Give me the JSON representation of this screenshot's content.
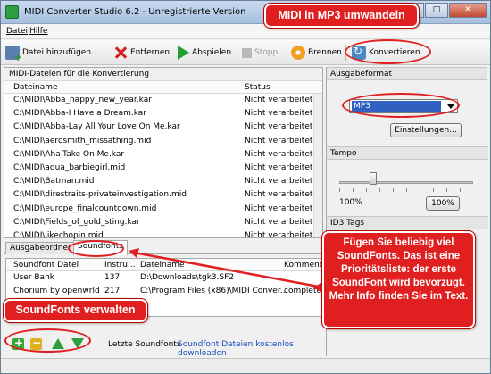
{
  "window": {
    "title": "MIDI Converter Studio 6.2 - Unregistrierte Version"
  },
  "menu": {
    "items": [
      "Datei",
      "Hilfe"
    ]
  },
  "toolbar": {
    "add_files": "Datei hinzufügen...",
    "remove": "Entfernen",
    "play": "Abspielen",
    "stop": "Stopp",
    "burn": "Brennen",
    "convert": "Konvertieren"
  },
  "file_list": {
    "title": "MIDI-Dateien für die Konvertierung",
    "columns": [
      "Dateiname",
      "Status"
    ],
    "rows": [
      {
        "name": "C:\\MIDI\\Abba_happy_new_year.kar",
        "status": "Nicht verarbeitet"
      },
      {
        "name": "C:\\MIDI\\Abba-I Have a Dream.kar",
        "status": "Nicht verarbeitet"
      },
      {
        "name": "C:\\MIDI\\Abba-Lay All Your Love On Me.kar",
        "status": "Nicht verarbeitet"
      },
      {
        "name": "C:\\MIDI\\aerosmith_missathing.mid",
        "status": "Nicht verarbeitet"
      },
      {
        "name": "C:\\MIDI\\Aha-Take On Me.kar",
        "status": "Nicht verarbeitet"
      },
      {
        "name": "C:\\MIDI\\aqua_barbiegirl.mid",
        "status": "Nicht verarbeitet"
      },
      {
        "name": "C:\\MIDI\\Batman.mid",
        "status": "Nicht verarbeitet"
      },
      {
        "name": "C:\\MIDI\\direstraits-privateinvestigation.mid",
        "status": "Nicht verarbeitet"
      },
      {
        "name": "C:\\MIDI\\europe_finalcountdown.mid",
        "status": "Nicht verarbeitet"
      },
      {
        "name": "C:\\MIDI\\Fields_of_gold_sting.kar",
        "status": "Nicht verarbeitet"
      },
      {
        "name": "C:\\MIDI\\likechopin.mid",
        "status": "Nicht verarbeitet"
      }
    ]
  },
  "tabs": [
    "Ausgabeordner",
    "Soundfonts"
  ],
  "soundfonts": {
    "columns": [
      "Soundfont Datei",
      "Instru...",
      "Dateiname",
      "Kommenta"
    ],
    "rows": [
      {
        "file": "User Bank",
        "instr": "137",
        "filename": "D:\\Downloads\\tgk3.SF2",
        "comment": ""
      },
      {
        "file": "Chorium by openwrld",
        "instr": "217",
        "filename": "C:\\Program Files (x86)\\MIDI Conver...",
        "comment": "complete C"
      }
    ],
    "last_label": "Letzte Soundfonts",
    "download_link": "Soundfont Dateien kostenlos downloaden"
  },
  "right_panel": {
    "output_format_head": "Ausgabeformat",
    "format_value": "MP3",
    "settings_button": "Einstellungen...",
    "tempo_head": "Tempo",
    "tempo_value_label": "100%",
    "tempo_reset_button": "100%",
    "tempo_fraction": 0.25,
    "id3_head": "ID3 Tags"
  },
  "annotations": {
    "top": "MIDI in MP3 umwandeln",
    "info": "Fügen Sie beliebig viel SoundFonts. Das ist eine Prioritätsliste: der erste SoundFont wird bevorzugt. Mehr Info finden Sie im Text.",
    "bottom": "SoundFonts verwalten",
    "color": "#e02020"
  }
}
